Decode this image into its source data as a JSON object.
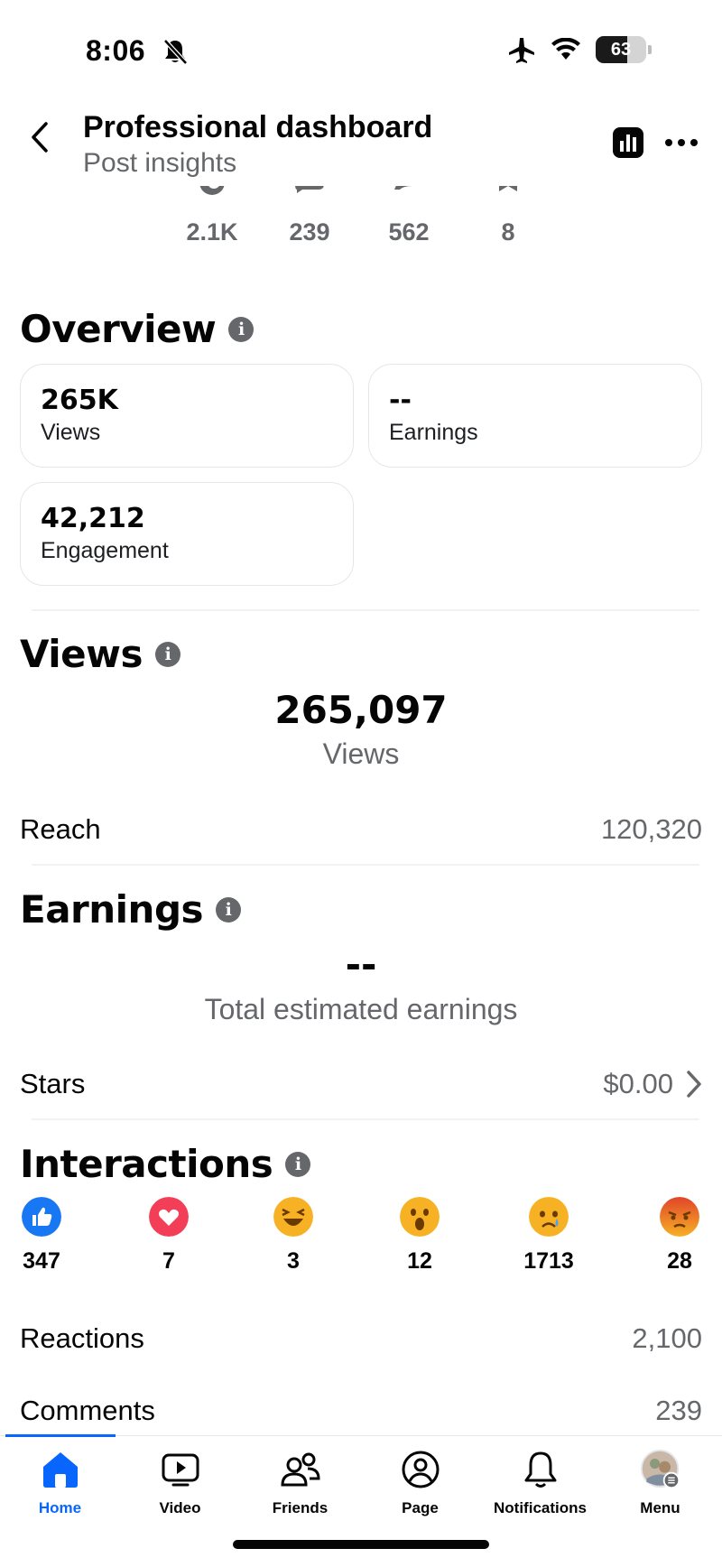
{
  "status_bar": {
    "time": "8:06",
    "battery": "63",
    "battery_level": 0.63
  },
  "header": {
    "title": "Professional dashboard",
    "subtitle": "Post insights"
  },
  "top_counts": [
    {
      "icon": "reaction-icon",
      "value": "2.1K"
    },
    {
      "icon": "comment-icon",
      "value": "239"
    },
    {
      "icon": "share-icon",
      "value": "562"
    },
    {
      "icon": "bookmark-icon",
      "value": "8"
    }
  ],
  "overview": {
    "title": "Overview",
    "cards": [
      {
        "value": "265K",
        "label": "Views"
      },
      {
        "value": "--",
        "label": "Earnings"
      },
      {
        "value": "42,212",
        "label": "Engagement"
      }
    ]
  },
  "views": {
    "title": "Views",
    "total": "265,097",
    "total_label": "Views",
    "reach_label": "Reach",
    "reach_value": "120,320"
  },
  "earnings": {
    "title": "Earnings",
    "total": "--",
    "total_label": "Total estimated earnings",
    "stars_label": "Stars",
    "stars_value": "$0.00"
  },
  "interactions": {
    "title": "Interactions",
    "reactions": [
      {
        "icon": "like-icon",
        "count": "347",
        "color": "#1877f2"
      },
      {
        "icon": "love-icon",
        "count": "7",
        "color": "#f33e58"
      },
      {
        "icon": "haha-icon",
        "count": "3",
        "color": "#f7b125"
      },
      {
        "icon": "wow-icon",
        "count": "12",
        "color": "#f7b125"
      },
      {
        "icon": "sad-icon",
        "count": "1713",
        "color": "#f7b125"
      },
      {
        "icon": "angry-icon",
        "count": "28",
        "color": "#e9710f"
      }
    ],
    "rows": [
      {
        "label": "Reactions",
        "value": "2,100"
      },
      {
        "label": "Comments",
        "value": "239"
      }
    ]
  },
  "bottom_nav": [
    {
      "label": "Home",
      "icon": "home-icon",
      "active": true
    },
    {
      "label": "Video",
      "icon": "video-icon",
      "active": false
    },
    {
      "label": "Friends",
      "icon": "friends-icon",
      "active": false
    },
    {
      "label": "Page",
      "icon": "page-icon",
      "active": false
    },
    {
      "label": "Notifications",
      "icon": "bell-icon",
      "active": false
    },
    {
      "label": "Menu",
      "icon": "avatar-icon",
      "active": false
    }
  ],
  "colors": {
    "accent": "#0866ff",
    "secondary_text": "#65676b",
    "divider": "#e4e6eb"
  }
}
